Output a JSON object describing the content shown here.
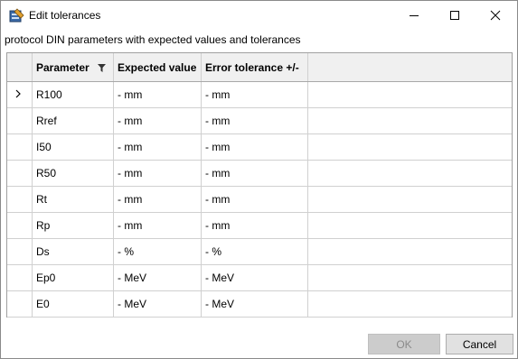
{
  "window": {
    "title": "Edit tolerances",
    "subtitle": "protocol DIN parameters with expected values and tolerances"
  },
  "grid": {
    "headers": {
      "parameter": "Parameter",
      "expected": "Expected value",
      "tolerance": "Error tolerance +/-"
    },
    "rows": [
      {
        "parameter": "R100",
        "expected": "- mm",
        "tolerance": "- mm"
      },
      {
        "parameter": "Rref",
        "expected": "- mm",
        "tolerance": "- mm"
      },
      {
        "parameter": "I50",
        "expected": "- mm",
        "tolerance": "- mm"
      },
      {
        "parameter": "R50",
        "expected": "- mm",
        "tolerance": "- mm"
      },
      {
        "parameter": "Rt",
        "expected": "- mm",
        "tolerance": "- mm"
      },
      {
        "parameter": "Rp",
        "expected": "- mm",
        "tolerance": "- mm"
      },
      {
        "parameter": "Ds",
        "expected": "- %",
        "tolerance": "- %"
      },
      {
        "parameter": "Ep0",
        "expected": "- MeV",
        "tolerance": "- MeV"
      },
      {
        "parameter": "E0",
        "expected": "- MeV",
        "tolerance": "- MeV"
      }
    ]
  },
  "buttons": {
    "ok": "OK",
    "cancel": "Cancel"
  },
  "icons": {
    "app": "edit-tolerances-app-icon",
    "minimize": "minimize-icon",
    "maximize": "maximize-icon",
    "close": "close-icon",
    "filter": "filter-icon",
    "row_indicator": "chevron-right-icon"
  }
}
